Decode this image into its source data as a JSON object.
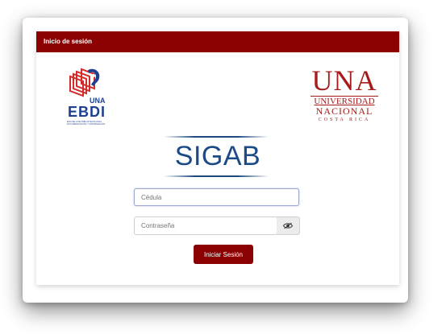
{
  "header": {
    "title": "Inicio de sesión",
    "background_color": "#8b0000"
  },
  "logos": {
    "ebdi": {
      "una_text": "UNA",
      "ebdi_text": "EBDI",
      "subtitle": "ESCUELA DE BIBLIOTECOLOGÍA DOCUMENTACIÓN Y INFORMACIÓN"
    },
    "una": {
      "big_text": "UNA",
      "line1": "UNIVERSIDAD",
      "line2": "NACIONAL",
      "line3": "COSTA RICA",
      "color": "#a61b1b"
    }
  },
  "app": {
    "name": "SIGAB",
    "color": "#1b4a87"
  },
  "form": {
    "cedula_placeholder": "Cédula",
    "password_placeholder": "Contraseña",
    "toggle_icon": "eye-icon",
    "submit_label": "Iniciar Sesión",
    "submit_color": "#8b0000"
  }
}
